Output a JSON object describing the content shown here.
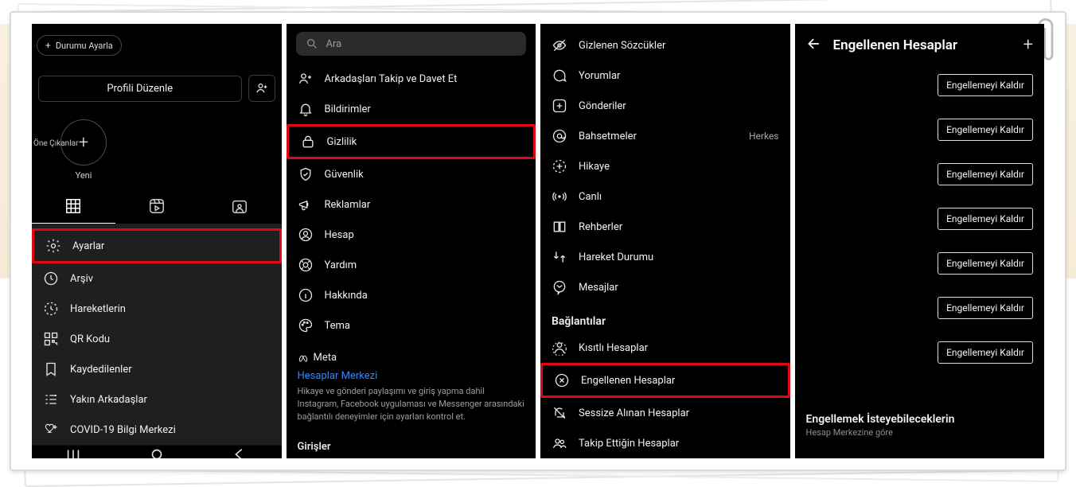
{
  "shot1": {
    "status_set": "Durumu Ayarla",
    "edit_profile": "Profili Düzenle",
    "highlights_caption": "Öne Çıkanlar",
    "highlights_new": "Yeni",
    "menu": [
      {
        "icon": "gear",
        "label": "Ayarlar",
        "hl": true
      },
      {
        "icon": "archive",
        "label": "Arşiv"
      },
      {
        "icon": "activity",
        "label": "Hareketlerin"
      },
      {
        "icon": "qr",
        "label": "QR Kodu"
      },
      {
        "icon": "bookmark",
        "label": "Kaydedilenler"
      },
      {
        "icon": "list-star",
        "label": "Yakın Arkadaşlar"
      },
      {
        "icon": "heart-plus",
        "label": "COVID-19 Bilgi Merkezi"
      }
    ]
  },
  "shot2": {
    "search_placeholder": "Ara",
    "items": [
      {
        "icon": "user-plus",
        "label": "Arkadaşları Takip ve Davet Et"
      },
      {
        "icon": "bell",
        "label": "Bildirimler"
      },
      {
        "icon": "lock",
        "label": "Gizlilik",
        "hl": true
      },
      {
        "icon": "shield",
        "label": "Güvenlik"
      },
      {
        "icon": "megaphone",
        "label": "Reklamlar"
      },
      {
        "icon": "account",
        "label": "Hesap"
      },
      {
        "icon": "life-ring",
        "label": "Yardım"
      },
      {
        "icon": "info",
        "label": "Hakkında"
      },
      {
        "icon": "palette",
        "label": "Tema"
      }
    ],
    "meta_label": "Meta",
    "accounts_center": "Hesaplar Merkezi",
    "meta_desc": "Hikaye ve gönderi paylaşımı ve giriş yapma dahil Instagram, Facebook uygulaması ve Messenger arasındaki bağlantılı deneyimler için ayarları kontrol et.",
    "logins_section": "Girişler"
  },
  "shot3": {
    "items": [
      {
        "icon": "eye-off",
        "label": "Gizlenen Sözcükler"
      },
      {
        "icon": "chat",
        "label": "Yorumlar"
      },
      {
        "icon": "plus-sq",
        "label": "Gönderiler"
      },
      {
        "icon": "at",
        "label": "Bahsetmeler",
        "trail": "Herkes"
      },
      {
        "icon": "story",
        "label": "Hikaye"
      },
      {
        "icon": "live",
        "label": "Canlı"
      },
      {
        "icon": "book",
        "label": "Rehberler"
      },
      {
        "icon": "arrows",
        "label": "Hareket Durumu"
      },
      {
        "icon": "msg",
        "label": "Mesajlar"
      }
    ],
    "connections_section": "Bağlantılar",
    "connections": [
      {
        "icon": "user-x",
        "label": "Kısıtlı Hesaplar"
      },
      {
        "icon": "x-circle",
        "label": "Engellenen Hesaplar",
        "hl": true
      },
      {
        "icon": "bell-off",
        "label": "Sessize Alınan Hesaplar"
      },
      {
        "icon": "users",
        "label": "Takip Ettiğin Hesaplar"
      }
    ]
  },
  "shot4": {
    "title": "Engellenen Hesaplar",
    "unblock_label": "Engellemeyi Kaldır",
    "entries": [
      {
        "hl": true
      },
      {},
      {},
      {},
      {},
      {},
      {}
    ],
    "suggest_title": "Engellemek İsteyebileceklerin",
    "suggest_sub": "Hesap Merkezine göre"
  }
}
